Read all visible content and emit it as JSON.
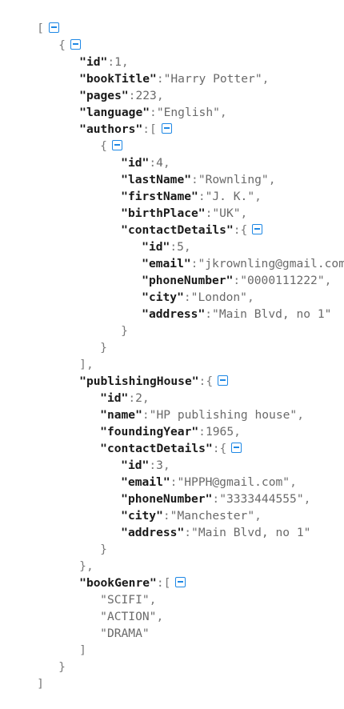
{
  "punct": {
    "open_bracket": "[",
    "close_bracket": "]",
    "open_brace": "{",
    "close_brace": "}",
    "close_bracket_comma": "],",
    "close_brace_comma": "},",
    "colon": ":",
    "comma": ","
  },
  "root": {
    "book": {
      "id_key": "\"id\"",
      "id_val": "1",
      "title_key": "\"bookTitle\"",
      "title_val": "\"Harry Potter\"",
      "pages_key": "\"pages\"",
      "pages_val": "223",
      "language_key": "\"language\"",
      "language_val": "\"English\"",
      "authors_key": "\"authors\"",
      "author": {
        "id_key": "\"id\"",
        "id_val": "4",
        "lastName_key": "\"lastName\"",
        "lastName_val": "\"Rownling\"",
        "firstName_key": "\"firstName\"",
        "firstName_val": "\"J. K.\"",
        "birthPlace_key": "\"birthPlace\"",
        "birthPlace_val": "\"UK\"",
        "contact_key": "\"contactDetails\"",
        "contact": {
          "id_key": "\"id\"",
          "id_val": "5",
          "email_key": "\"email\"",
          "email_val": "\"jkrownling@gmail.com\"",
          "phone_key": "\"phoneNumber\"",
          "phone_val": "\"0000111222\"",
          "city_key": "\"city\"",
          "city_val": "\"London\"",
          "address_key": "\"address\"",
          "address_val": "\"Main Blvd, no 1\""
        }
      },
      "publisher_key": "\"publishingHouse\"",
      "publisher": {
        "id_key": "\"id\"",
        "id_val": "2",
        "name_key": "\"name\"",
        "name_val": "\"HP publishing house\"",
        "founding_key": "\"foundingYear\"",
        "founding_val": "1965",
        "contact_key": "\"contactDetails\"",
        "contact": {
          "id_key": "\"id\"",
          "id_val": "3",
          "email_key": "\"email\"",
          "email_val": "\"HPPH@gmail.com\"",
          "phone_key": "\"phoneNumber\"",
          "phone_val": "\"3333444555\"",
          "city_key": "\"city\"",
          "city_val": "\"Manchester\"",
          "address_key": "\"address\"",
          "address_val": "\"Main Blvd, no 1\""
        }
      },
      "genre_key": "\"bookGenre\"",
      "genres": [
        "\"SCIFI\"",
        "\"ACTION\"",
        "\"DRAMA\""
      ]
    }
  },
  "icons": {
    "toggle": "collapse-icon",
    "toggle_color": "#1e88e5"
  }
}
